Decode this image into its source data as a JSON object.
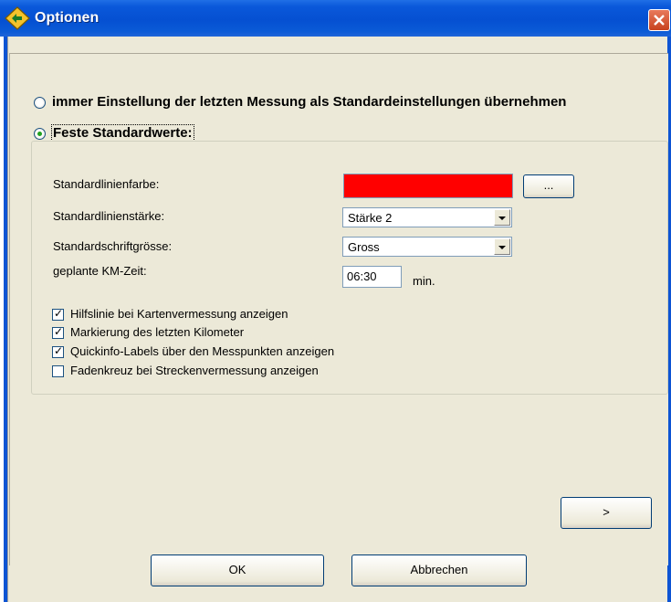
{
  "window": {
    "title": "Optionen"
  },
  "options": {
    "radio_last": {
      "label": "immer Einstellung der letzten Messung als Standardeinstellungen übernehmen",
      "checked": false
    },
    "radio_fixed": {
      "label": "Feste Standardwerte:",
      "checked": true
    }
  },
  "fields": {
    "line_color": {
      "label": "Standardlinienfarbe:",
      "value_color": "#ff0000",
      "button_label": "..."
    },
    "line_width": {
      "label": "Standardlinienstärke:",
      "value": "Stärke 2"
    },
    "font_size": {
      "label": "Standardschriftgrösse:",
      "value": "Gross"
    },
    "km_time": {
      "label": "geplante KM-Zeit:",
      "value": "06:30",
      "unit": "min."
    }
  },
  "checkboxes": [
    {
      "label": "Hilfslinie bei Kartenvermessung anzeigen",
      "checked": true
    },
    {
      "label": "Markierung des letzten Kilometer",
      "checked": true
    },
    {
      "label": "Quickinfo-Labels über den Messpunkten anzeigen",
      "checked": true
    },
    {
      "label": "Fadenkreuz bei Streckenvermessung anzeigen",
      "checked": false
    }
  ],
  "buttons": {
    "next": ">",
    "ok": "OK",
    "cancel": "Abbrechen"
  }
}
